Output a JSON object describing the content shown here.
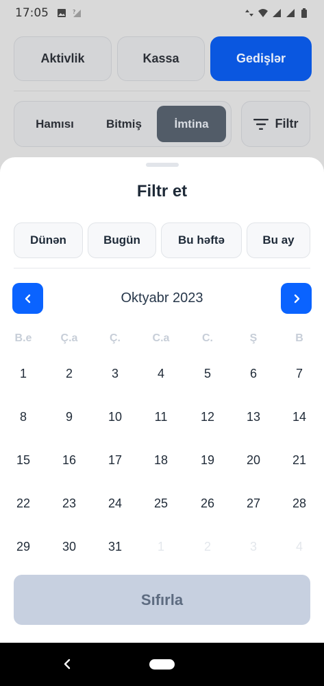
{
  "status_bar": {
    "time": "17:05",
    "icons": [
      "image-icon",
      "signal-question-icon",
      "data-arrows-icon",
      "wifi-icon",
      "signal-icon",
      "signal-icon",
      "battery-icon"
    ]
  },
  "background": {
    "top_tabs": [
      {
        "label": "Aktivlik",
        "active": false
      },
      {
        "label": "Kassa",
        "active": false
      },
      {
        "label": "Gedişlər",
        "active": true
      }
    ],
    "status_segments": [
      {
        "label": "Hamısı",
        "active": false
      },
      {
        "label": "Bitmiş",
        "active": false
      },
      {
        "label": "İmtina",
        "active": true
      }
    ],
    "filter_button": {
      "label": "Filtr",
      "icon": "filter-icon"
    }
  },
  "sheet": {
    "title": "Filtr et",
    "quick_filters": [
      "Dünən",
      "Bugün",
      "Bu həftə",
      "Bu ay"
    ],
    "calendar": {
      "month_label": "Oktyabr 2023",
      "prev_icon": "chevron-left-icon",
      "next_icon": "chevron-right-icon",
      "weekdays": [
        "B.e",
        "Ç.a",
        "Ç.",
        "C.a",
        "C.",
        "Ş",
        "B"
      ],
      "weeks": [
        [
          "1",
          "2",
          "3",
          "4",
          "5",
          "6",
          "7"
        ],
        [
          "8",
          "9",
          "10",
          "11",
          "12",
          "13",
          "14"
        ],
        [
          "15",
          "16",
          "17",
          "18",
          "19",
          "20",
          "21"
        ],
        [
          "22",
          "23",
          "24",
          "25",
          "26",
          "27",
          "28"
        ],
        [
          "29",
          "30",
          "31",
          "1",
          "2",
          "3",
          "4"
        ]
      ],
      "next_month_days_in_last_week": 4
    },
    "reset_button": "Sıfırla"
  },
  "colors": {
    "accent": "#0a63ff",
    "reset_bg": "#c7d0e0",
    "muted_day": "#e3e7ec",
    "weekday": "#c7ced8"
  }
}
